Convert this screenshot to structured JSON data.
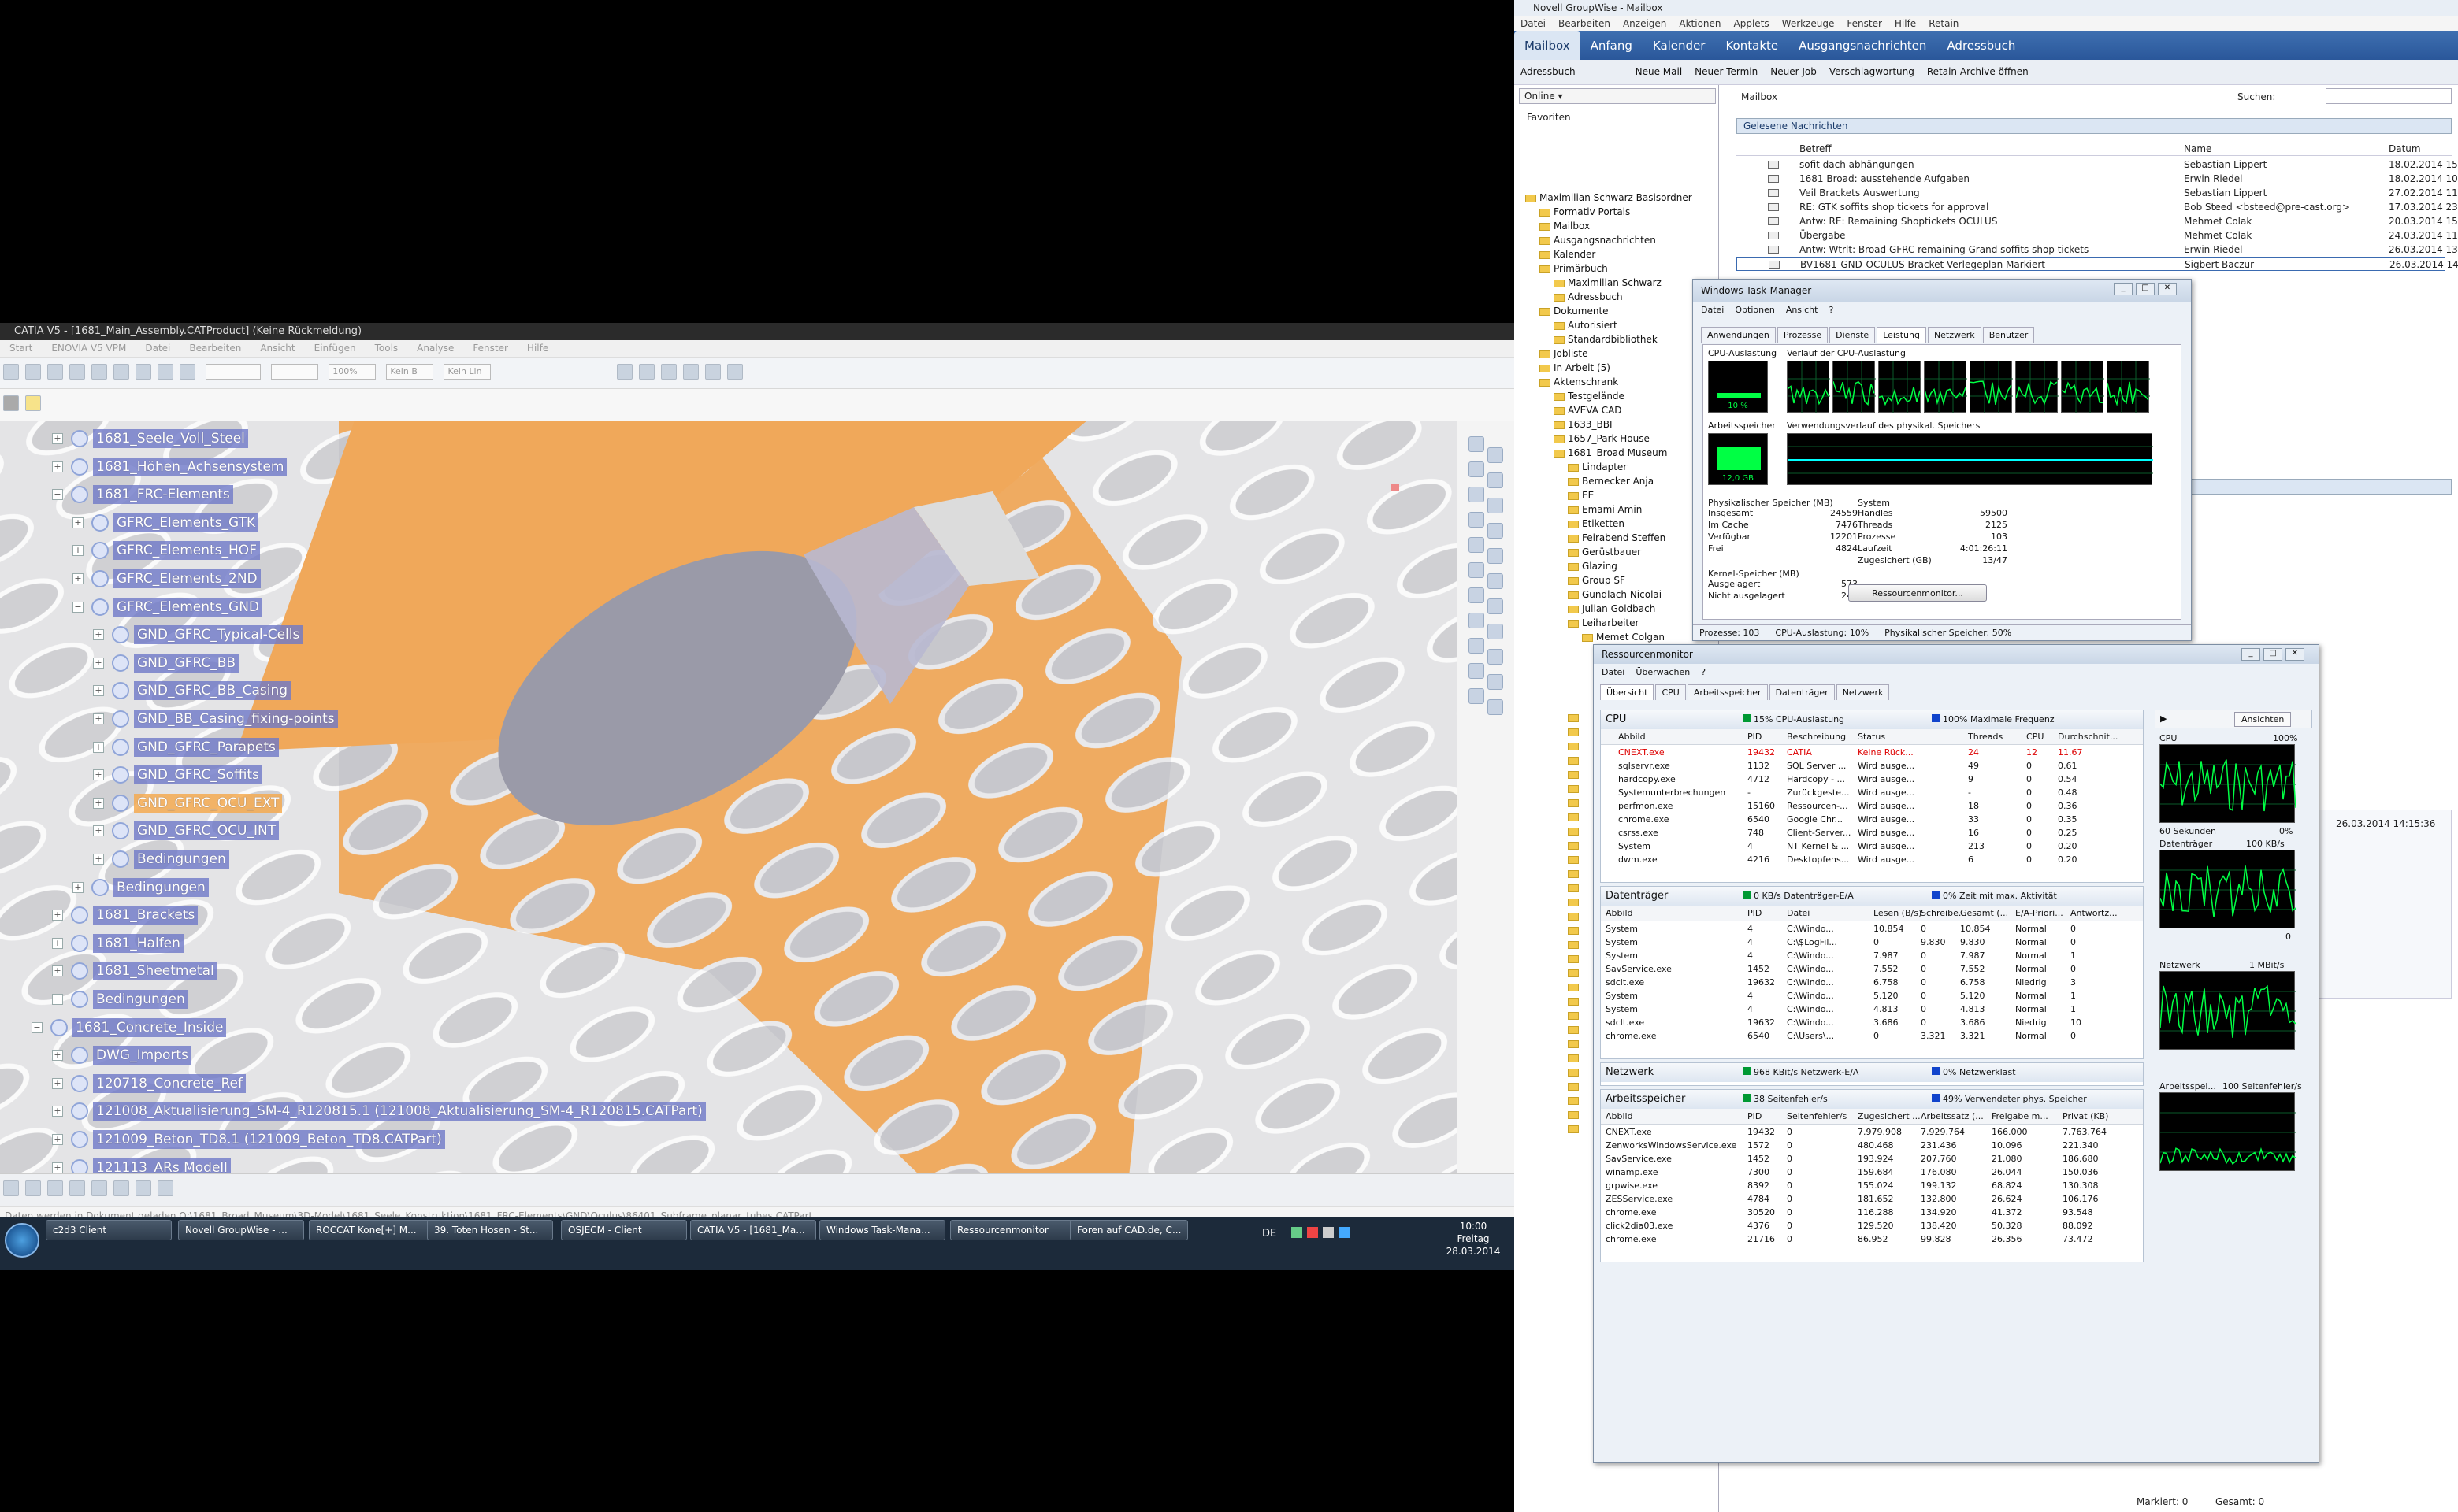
{
  "catia": {
    "title": "CATIA V5 - [1681_Main_Assembly.CATProduct] (Keine Rückmeldung)",
    "menu": [
      "Start",
      "ENOVIA V5 VPM",
      "Datei",
      "Bearbeiten",
      "Ansicht",
      "Einfügen",
      "Tools",
      "Analyse",
      "Fenster",
      "Hilfe"
    ],
    "combo_zoom": "100%",
    "combo_b": "Kein B",
    "combo_lin": "Kein Lin",
    "tree": [
      {
        "label": "1681_Seele_Voll_Steel",
        "level": 0,
        "exp": "+"
      },
      {
        "label": "1681_Höhen_Achsensystem",
        "level": 0,
        "exp": "+"
      },
      {
        "label": "1681_FRC-Elements",
        "level": 0,
        "exp": "−"
      },
      {
        "label": "GFRC_Elements_GTK",
        "level": 1,
        "exp": "+"
      },
      {
        "label": "GFRC_Elements_HOF",
        "level": 1,
        "exp": "+"
      },
      {
        "label": "GFRC_Elements_2ND",
        "level": 1,
        "exp": "+"
      },
      {
        "label": "GFRC_Elements_GND",
        "level": 1,
        "exp": "−"
      },
      {
        "label": "GND_GFRC_Typical-Cells",
        "level": 2,
        "exp": "+"
      },
      {
        "label": "GND_GFRC_BB",
        "level": 2,
        "exp": "+"
      },
      {
        "label": "GND_GFRC_BB_Casing",
        "level": 2,
        "exp": "+"
      },
      {
        "label": "GND_BB_Casing_fixing-points",
        "level": 2,
        "exp": "+"
      },
      {
        "label": "GND_GFRC_Parapets",
        "level": 2,
        "exp": "+"
      },
      {
        "label": "GND_GFRC_Soffits",
        "level": 2,
        "exp": "+"
      },
      {
        "label": "GND_GFRC_OCU_EXT",
        "level": 2,
        "exp": "+",
        "orange": true
      },
      {
        "label": "GND_GFRC_OCU_INT",
        "level": 2,
        "exp": "+"
      },
      {
        "label": "Bedingungen",
        "level": 2,
        "exp": "+"
      },
      {
        "label": "Bedingungen",
        "level": 1,
        "exp": "+"
      },
      {
        "label": "1681_Brackets",
        "level": 0,
        "exp": "+"
      },
      {
        "label": "1681_Halfen",
        "level": 0,
        "exp": "+"
      },
      {
        "label": "1681_Sheetmetal",
        "level": 0,
        "exp": "+"
      },
      {
        "label": "Bedingungen",
        "level": 0,
        "exp": ""
      },
      {
        "label": "1681_Concrete_Inside",
        "level": -1,
        "exp": "−"
      },
      {
        "label": "DWG_Imports",
        "level": 0,
        "exp": "+"
      },
      {
        "label": "120718_Concrete_Ref",
        "level": 0,
        "exp": "+"
      },
      {
        "label": "121008_Aktualisierung_SM-4_R120815.1 (121008_Aktualisierung_SM-4_R120815.CATPart)",
        "level": 0,
        "exp": "+"
      },
      {
        "label": "121009_Beton_TD8.1 (121009_Beton_TD8.CATPart)",
        "level": 0,
        "exp": "+"
      },
      {
        "label": "121113_ARs Modell",
        "level": 0,
        "exp": "+"
      }
    ],
    "status_line": "Daten werden in Dokument geladen Q:\\1681_Broad_Museum\\3D-Model\\1681_Seele_Konstruktion\\1681_FRC-Elements\\GND\\Oculus\\86401_Subframe_planar_tubes.CATPart"
  },
  "taskbar": {
    "tasks": [
      "c2d3 Client",
      "Novell GroupWise - ...",
      "ROCCAT Kone[+] M...",
      "39. Toten Hosen - St...",
      "OSJECM - Client",
      "CATIA V5 - [1681_Ma...",
      "Windows Task-Mana...",
      "Ressourcenmonitor",
      "Foren auf CAD.de, C..."
    ],
    "lang": "DE",
    "time": "10:00",
    "day": "Freitag",
    "date": "28.03.2014"
  },
  "groupwise": {
    "title": "Novell GroupWise - Mailbox",
    "menu": [
      "Datei",
      "Bearbeiten",
      "Anzeigen",
      "Aktionen",
      "Applets",
      "Werkzeuge",
      "Fenster",
      "Hilfe",
      "Retain"
    ],
    "tabs": [
      "Mailbox",
      "Anfang",
      "Kalender",
      "Kontakte",
      "Ausgangsnachrichten",
      "Adressbuch"
    ],
    "tools": [
      "Adressbuch",
      "Neue Mail",
      "Neuer Termin",
      "Neuer Job",
      "Verschlagwortung",
      "Retain Archive öffnen"
    ],
    "online": "Online",
    "favorites": "Favoriten",
    "mailbox_label": "Mailbox",
    "search_label": "Suchen:",
    "folder_header": "Gelesene Nachrichten",
    "cols": {
      "subject": "Betreff",
      "name": "Name",
      "date": "Datum"
    },
    "messages": [
      {
        "subject": "sofit dach abhängungen",
        "name": "Sebastian Lippert",
        "date": "18.02.2014 15:"
      },
      {
        "subject": "1681 Broad: ausstehende Aufgaben",
        "name": "Erwin Riedel",
        "date": "18.02.2014 10:4"
      },
      {
        "subject": "Veil Brackets Auswertung",
        "name": "Sebastian Lippert",
        "date": "27.02.2014 11:2"
      },
      {
        "subject": "RE: GTK soffits shop tickets for approval",
        "name": "Bob Steed <bsteed@pre-cast.org>",
        "date": "17.03.2014 23:2"
      },
      {
        "subject": "Antw: RE: Remaining Shoptickets OCULUS",
        "name": "Mehmet Colak",
        "date": "20.03.2014 15:1"
      },
      {
        "subject": "Übergabe",
        "name": "Mehmet Colak",
        "date": "24.03.2014 11:0"
      },
      {
        "subject": "Antw: Wtrlt: Broad GFRC remaining Grand soffits shop tickets",
        "name": "Erwin Riedel",
        "date": "26.03.2014 13:0"
      },
      {
        "subject": "BV1681-GND-OCULUS Bracket Verlegeplan Markiert",
        "name": "Sigbert Baczur",
        "date": "26.03.2014 14:1"
      }
    ],
    "tree": [
      {
        "label": "Maximilian Schwarz Basisordner",
        "indent": 0
      },
      {
        "label": "Formativ Portals",
        "indent": 1
      },
      {
        "label": "Mailbox",
        "indent": 1
      },
      {
        "label": "Ausgangsnachrichten",
        "indent": 1
      },
      {
        "label": "Kalender",
        "indent": 1
      },
      {
        "label": "Primärbuch",
        "indent": 1
      },
      {
        "label": "Maximilian Schwarz",
        "indent": 2
      },
      {
        "label": "Adressbuch",
        "indent": 2
      },
      {
        "label": "Dokumente",
        "indent": 1
      },
      {
        "label": "Autorisiert",
        "indent": 2
      },
      {
        "label": "Standardbibliothek",
        "indent": 2
      },
      {
        "label": "Jobliste",
        "indent": 1
      },
      {
        "label": "In Arbeit (5)",
        "indent": 1
      },
      {
        "label": "Aktenschrank",
        "indent": 1
      },
      {
        "label": "Testgelände",
        "indent": 2
      },
      {
        "label": "AVEVA CAD",
        "indent": 2
      },
      {
        "label": "1633_BBI",
        "indent": 2
      },
      {
        "label": "1657_Park House",
        "indent": 2
      },
      {
        "label": "1681_Broad Museum",
        "indent": 2
      },
      {
        "label": "Lindapter",
        "indent": 3
      },
      {
        "label": "Bernecker Anja",
        "indent": 3
      },
      {
        "label": "EE",
        "indent": 3
      },
      {
        "label": "Emami Amin",
        "indent": 3
      },
      {
        "label": "Etiketten",
        "indent": 3
      },
      {
        "label": "Feirabend Steffen",
        "indent": 3
      },
      {
        "label": "Gerüstbauer",
        "indent": 3
      },
      {
        "label": "Glazing",
        "indent": 3
      },
      {
        "label": "Group SF",
        "indent": 3
      },
      {
        "label": "Gundlach Nicolai",
        "indent": 3
      },
      {
        "label": "Julian Goldbach",
        "indent": 3
      },
      {
        "label": "Leiharbeiter",
        "indent": 3
      },
      {
        "label": "Memet Colgan",
        "indent": 4
      }
    ],
    "status_mark": "Markiert: 0",
    "status_total": "Gesamt: 0",
    "side_date": "26.03.2014 14:15:36"
  },
  "taskmgr": {
    "title": "Windows Task-Manager",
    "menu": [
      "Datei",
      "Optionen",
      "Ansicht",
      "?"
    ],
    "tabs": [
      "Anwendungen",
      "Prozesse",
      "Dienste",
      "Leistung",
      "Netzwerk",
      "Benutzer"
    ],
    "cpu_usage_label": "CPU-Auslastung",
    "cpu_history_label": "Verlauf der CPU-Auslastung",
    "mem_label": "Arbeitsspeicher",
    "mem_history_label": "Verwendungsverlauf des physikal. Speichers",
    "cpu_pct": "10 %",
    "mem_val": "12,0 GB",
    "phys_title": "Physikalischer Speicher (MB)",
    "phys": [
      [
        "Insgesamt",
        "24559"
      ],
      [
        "Im Cache",
        "7476"
      ],
      [
        "Verfügbar",
        "12201"
      ],
      [
        "Frei",
        "4824"
      ]
    ],
    "sys_title": "System",
    "sys": [
      [
        "Handles",
        "59500"
      ],
      [
        "Threads",
        "2125"
      ],
      [
        "Prozesse",
        "103"
      ],
      [
        "Laufzeit",
        "4:01:26:11"
      ],
      [
        "Zugesichert (GB)",
        "13/47"
      ]
    ],
    "kernel_title": "Kernel-Speicher (MB)",
    "kernel": [
      [
        "Ausgelagert",
        "573"
      ],
      [
        "Nicht ausgelagert",
        "244"
      ]
    ],
    "resmon_button": "Ressourcenmonitor...",
    "status": [
      "Prozesse: 103",
      "CPU-Auslastung: 10%",
      "Physikalischer Speicher: 50%"
    ]
  },
  "resmon": {
    "title": "Ressourcenmonitor",
    "menu": [
      "Datei",
      "Überwachen",
      "?"
    ],
    "tabs": [
      "Übersicht",
      "CPU",
      "Arbeitsspeicher",
      "Datenträger",
      "Netzwerk"
    ],
    "cpu": {
      "title": "CPU",
      "usage": "15% CPU-Auslastung",
      "freq": "100% Maximale Frequenz",
      "cols": [
        "Abbild",
        "PID",
        "Beschreibung",
        "Status",
        "Threads",
        "CPU",
        "Durchschnit..."
      ],
      "rows": [
        [
          "CNEXT.exe",
          "19432",
          "CATIA",
          "Keine Rück...",
          "24",
          "12",
          "11.67"
        ],
        [
          "sqlservr.exe",
          "1132",
          "SQL Server ...",
          "Wird ausge...",
          "49",
          "0",
          "0.61"
        ],
        [
          "hardcopy.exe",
          "4712",
          "Hardcopy - ...",
          "Wird ausge...",
          "9",
          "0",
          "0.54"
        ],
        [
          "Systemunterbrechungen",
          "-",
          "Zurückgeste...",
          "Wird ausge...",
          "-",
          "0",
          "0.48"
        ],
        [
          "perfmon.exe",
          "15160",
          "Ressourcen-...",
          "Wird ausge...",
          "18",
          "0",
          "0.36"
        ],
        [
          "chrome.exe",
          "6540",
          "Google Chr...",
          "Wird ausge...",
          "33",
          "0",
          "0.35"
        ],
        [
          "csrss.exe",
          "748",
          "Client-Server...",
          "Wird ausge...",
          "16",
          "0",
          "0.25"
        ],
        [
          "System",
          "4",
          "NT Kernel & ...",
          "Wird ausge...",
          "213",
          "0",
          "0.20"
        ],
        [
          "dwm.exe",
          "4216",
          "Desktopfens...",
          "Wird ausge...",
          "6",
          "0",
          "0.20"
        ]
      ]
    },
    "disk": {
      "title": "Datenträger",
      "io": "0 KB/s Datenträger-E/A",
      "active": "0% Zeit mit max. Aktivität",
      "cols": [
        "Abbild",
        "PID",
        "Datei",
        "Lesen (B/s)",
        "Schreibe...",
        "Gesamt (...",
        "E/A-Priori...",
        "Antwortz..."
      ],
      "rows": [
        [
          "System",
          "4",
          "C:\\Windo...",
          "10.854",
          "0",
          "10.854",
          "Normal",
          "0"
        ],
        [
          "System",
          "4",
          "C:\\$LogFil...",
          "0",
          "9.830",
          "9.830",
          "Normal",
          "0"
        ],
        [
          "System",
          "4",
          "C:\\Windo...",
          "7.987",
          "0",
          "7.987",
          "Normal",
          "1"
        ],
        [
          "SavService.exe",
          "1452",
          "C:\\Windo...",
          "7.552",
          "0",
          "7.552",
          "Normal",
          "0"
        ],
        [
          "sdclt.exe",
          "19632",
          "C:\\Windo...",
          "6.758",
          "0",
          "6.758",
          "Niedrig",
          "3"
        ],
        [
          "System",
          "4",
          "C:\\Windo...",
          "5.120",
          "0",
          "5.120",
          "Normal",
          "1"
        ],
        [
          "System",
          "4",
          "C:\\Windo...",
          "4.813",
          "0",
          "4.813",
          "Normal",
          "1"
        ],
        [
          "sdclt.exe",
          "19632",
          "C:\\Windo...",
          "3.686",
          "0",
          "3.686",
          "Niedrig",
          "10"
        ],
        [
          "chrome.exe",
          "6540",
          "C:\\Users\\...",
          "0",
          "3.321",
          "3.321",
          "Normal",
          "0"
        ]
      ]
    },
    "net": {
      "title": "Netzwerk",
      "io": "968 KBit/s Netzwerk-E/A",
      "load": "0% Netzwerklast"
    },
    "mem": {
      "title": "Arbeitsspeicher",
      "faults": "38 Seitenfehler/s",
      "used": "49% Verwendeter phys. Speicher",
      "cols": [
        "Abbild",
        "PID",
        "Seitenfehler/s",
        "Zugesichert ...",
        "Arbeitssatz (...",
        "Freigabe m...",
        "Privat (KB)"
      ],
      "rows": [
        [
          "CNEXT.exe",
          "19432",
          "0",
          "7.979.908",
          "7.929.764",
          "166.000",
          "7.763.764"
        ],
        [
          "ZenworksWindowsService.exe",
          "1572",
          "0",
          "480.468",
          "231.436",
          "10.096",
          "221.340"
        ],
        [
          "SavService.exe",
          "1452",
          "0",
          "193.924",
          "207.760",
          "21.080",
          "186.680"
        ],
        [
          "winamp.exe",
          "7300",
          "0",
          "159.684",
          "176.080",
          "26.044",
          "150.036"
        ],
        [
          "grpwise.exe",
          "8392",
          "0",
          "155.024",
          "199.132",
          "68.824",
          "130.308"
        ],
        [
          "ZESService.exe",
          "4784",
          "0",
          "181.652",
          "132.800",
          "26.624",
          "106.176"
        ],
        [
          "chrome.exe",
          "30520",
          "0",
          "116.288",
          "134.920",
          "41.372",
          "93.548"
        ],
        [
          "click2dia03.exe",
          "4376",
          "0",
          "129.520",
          "138.420",
          "50.328",
          "88.092"
        ],
        [
          "chrome.exe",
          "21716",
          "0",
          "86.952",
          "99.828",
          "26.356",
          "73.472"
        ]
      ]
    },
    "side": {
      "view_button": "Ansichten",
      "cpu_label": "CPU",
      "cpu_pct": "100%",
      "sec": "60 Sekunden",
      "zero": "0%",
      "disk_label": "Datenträger",
      "disk_rate": "100 KB/s",
      "net_label": "Netzwerk",
      "net_rate": "1 MBit/s",
      "mem_label": "Arbeitsspei...",
      "mem_rate": "100 Seitenfehler/s",
      "zero2": "0"
    }
  },
  "colors": {
    "catia_orange": "#f0a85a",
    "tree_select": "#7078c8",
    "gw_blue": "#2f5f9f",
    "graph_green": "#00ff44"
  }
}
